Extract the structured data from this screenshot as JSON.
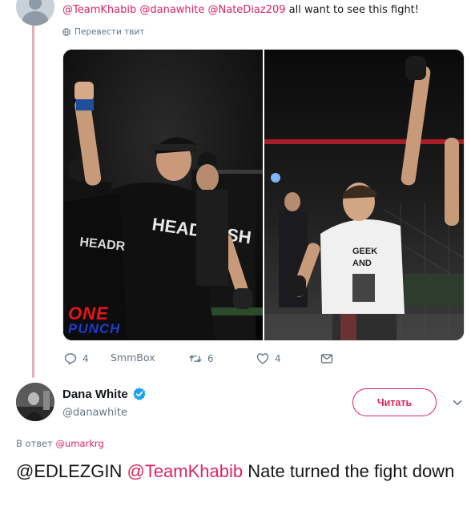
{
  "parent_tweet": {
    "text_mentions": [
      "@TeamKhabib",
      "@danawhite",
      "@NateDiaz209"
    ],
    "text_rest": "all want to see this fight!",
    "translate_label": "Перевести твит",
    "media": {
      "left_watermark_line1": "ONE",
      "left_watermark_line2": "PUNCH"
    },
    "actions": {
      "reply_count": "4",
      "via": "SmmBox",
      "retweet_count": "6",
      "like_count": "4"
    }
  },
  "reply_tweet": {
    "author_name": "Dana White",
    "author_handle": "@danawhite",
    "follow_label": "Читать",
    "reply_to_prefix": "В ответ",
    "reply_to_handle": "@umarkrg",
    "text_mention_1": "@EDLEZGIN",
    "text_mention_2": "@TeamKhabib",
    "text_rest": "Nate turned the fight down"
  },
  "colors": {
    "accent": "#e0245e",
    "muted": "#657786",
    "thread_line": "#e4aeb9",
    "verified": "#1da1f2"
  },
  "icons": [
    "globe-icon",
    "reply-icon",
    "retweet-icon",
    "like-icon",
    "dm-icon",
    "verified-icon",
    "chevron-down-icon"
  ]
}
